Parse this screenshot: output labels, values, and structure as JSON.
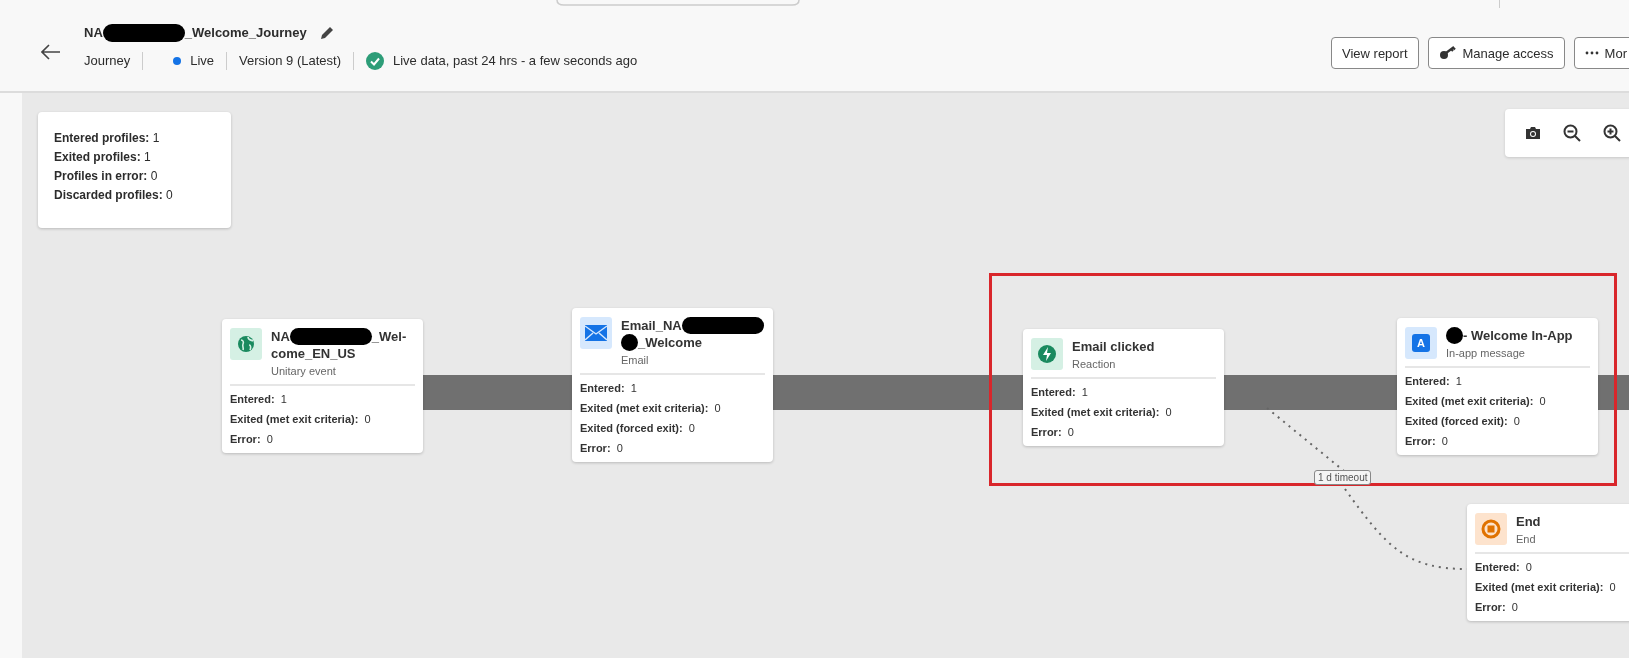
{
  "header": {
    "title_parts": [
      {
        "kind": "text",
        "text": "NA"
      },
      {
        "kind": "redacted"
      },
      {
        "kind": "text",
        "text": "_Welcome_Journey"
      }
    ],
    "type": "Journey",
    "status": {
      "label": "Live",
      "color": "#1473e6"
    },
    "version": "Version 9 (Latest)",
    "live_data": "Live data, past 24 hrs - a few seconds ago",
    "buttons": [
      {
        "kind": "plain",
        "label": "View report"
      },
      {
        "kind": "key",
        "label": "Manage access"
      },
      {
        "kind": "more",
        "label": "Mor"
      }
    ]
  },
  "summary": [
    "**Entered profiles:** 1",
    "**Exited profiles:** 1",
    "**Profiles in error:** 0",
    "**Discarded profiles:** 0"
  ],
  "nodes": [
    {
      "kind": "globe",
      "title_parts": [
        {
          "kind": "text",
          "text": "NA"
        },
        {
          "kind": "redacted"
        },
        {
          "kind": "text",
          "text": "_Wel-"
        },
        {
          "kind": "break"
        },
        {
          "kind": "text",
          "text": "come_EN_US"
        }
      ],
      "subtitle": "Unitary event",
      "stats": [
        "**Entered:**  1",
        "**Exited (met exit criteria):**  0",
        "**Error:**  0"
      ]
    },
    {
      "kind": "email",
      "title_parts": [
        {
          "kind": "text",
          "text": "Email_NA"
        },
        {
          "kind": "redacted"
        },
        {
          "kind": "break"
        },
        {
          "kind": "dot"
        },
        {
          "kind": "text",
          "text": "_Welcome"
        }
      ],
      "subtitle": "Email",
      "stats": [
        "**Entered:**  1",
        "**Exited (met exit criteria):**  0",
        "**Exited (forced exit):**  0",
        "**Error:**  0"
      ]
    },
    {
      "kind": "bolt",
      "title_parts": [
        {
          "kind": "text",
          "text": "Email clicked"
        }
      ],
      "subtitle": "Reaction",
      "stats": [
        "**Entered:**  1",
        "**Exited (met exit criteria):**  0",
        "**Error:**  0"
      ]
    },
    {
      "kind": "app",
      "icon_label": "A",
      "title_parts": [
        {
          "kind": "dot"
        },
        {
          "kind": "text",
          "text": "- Welcome In-App"
        }
      ],
      "subtitle": "In-app message",
      "stats": [
        "**Entered:**  1",
        "**Exited (met exit criteria):**  0",
        "**Exited (forced exit):**  0",
        "**Error:**  0"
      ]
    },
    {
      "kind": "stop",
      "title_parts": [
        {
          "kind": "text",
          "text": "End"
        }
      ],
      "subtitle": "End",
      "stats": [
        "**Entered:**  0",
        "**Exited (met exit criteria):**  0",
        "**Error:**  0"
      ]
    }
  ],
  "timeout_label": "1 d timeout"
}
